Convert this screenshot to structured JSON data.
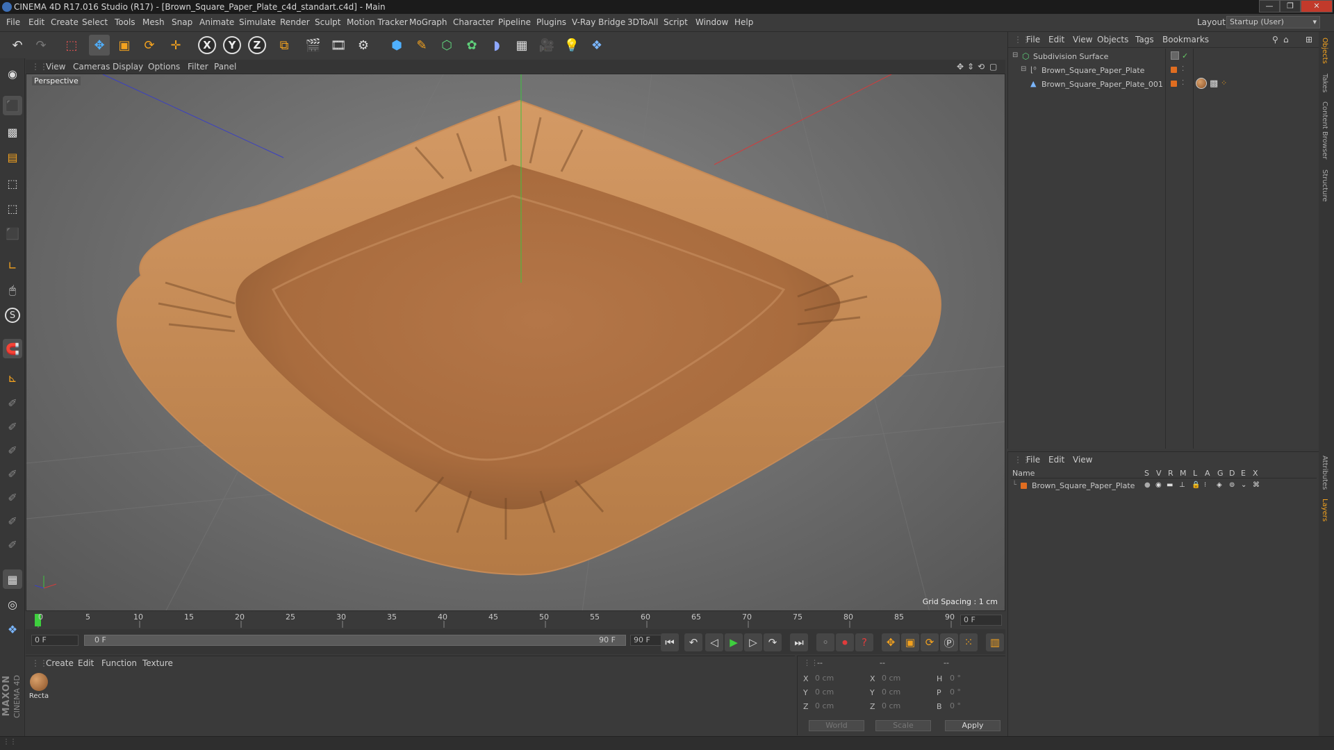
{
  "window": {
    "title": "CINEMA 4D R17.016 Studio (R17) - [Brown_Square_Paper_Plate_c4d_standart.c4d] - Main"
  },
  "menubar": {
    "items": [
      "File",
      "Edit",
      "Create",
      "Select",
      "Tools",
      "Mesh",
      "Snap",
      "Animate",
      "Simulate",
      "Render",
      "Sculpt",
      "Motion Tracker",
      "MoGraph",
      "Character",
      "Pipeline",
      "Plugins",
      "V-Ray Bridge",
      "3DToAll",
      "Script",
      "Window",
      "Help"
    ],
    "layout_label": "Layout:",
    "layout_value": "Startup (User)"
  },
  "viewport": {
    "menu": [
      "View",
      "Cameras",
      "Display",
      "Options",
      "Filter",
      "Panel"
    ],
    "camera": "Perspective",
    "grid_spacing": "Grid Spacing : 1 cm"
  },
  "timeline": {
    "ticks": [
      "0",
      "5",
      "10",
      "15",
      "20",
      "25",
      "30",
      "35",
      "40",
      "45",
      "50",
      "55",
      "60",
      "65",
      "70",
      "75",
      "80",
      "85",
      "90"
    ],
    "current_frame": "0 F",
    "start_frame": "0 F",
    "range_start": "0 F",
    "range_end": "90 F",
    "end_frame": "90 F"
  },
  "material_manager": {
    "menu": [
      "Create",
      "Edit",
      "Function",
      "Texture"
    ],
    "materials": [
      {
        "label": "Recta"
      }
    ]
  },
  "coordinates": {
    "headers": [
      "--",
      "--",
      "--"
    ],
    "rows": [
      {
        "axis": "X",
        "pos": "0 cm",
        "axis2": "X",
        "size": "0 cm",
        "rot_label": "H",
        "rot": "0 °"
      },
      {
        "axis": "Y",
        "pos": "0 cm",
        "axis2": "Y",
        "size": "0 cm",
        "rot_label": "P",
        "rot": "0 °"
      },
      {
        "axis": "Z",
        "pos": "0 cm",
        "axis2": "Z",
        "size": "0 cm",
        "rot_label": "B",
        "rot": "0 °"
      }
    ],
    "world": "World",
    "scale": "Scale",
    "apply": "Apply"
  },
  "object_manager": {
    "menu": [
      "File",
      "Edit",
      "View",
      "Objects",
      "Tags",
      "Bookmarks"
    ],
    "objects": [
      "Subdivision Surface",
      "Brown_Square_Paper_Plate",
      "Brown_Square_Paper_Plate_001"
    ]
  },
  "layer_manager": {
    "menu": [
      "File",
      "Edit",
      "View"
    ],
    "name_header": "Name",
    "columns": [
      "S",
      "V",
      "R",
      "M",
      "L",
      "A",
      "G",
      "D",
      "E",
      "X"
    ],
    "layers": [
      "Brown_Square_Paper_Plate"
    ]
  },
  "side_tabs": [
    "Objects",
    "Takes",
    "Content Browser",
    "Structure",
    "Attributes",
    "Layers"
  ],
  "brand": {
    "maxon": "MAXON",
    "product": "CINEMA 4D"
  },
  "colors": {
    "accent": "#4fb0ff",
    "layer_orange": "#e06d20",
    "plate": "#b67a45"
  }
}
